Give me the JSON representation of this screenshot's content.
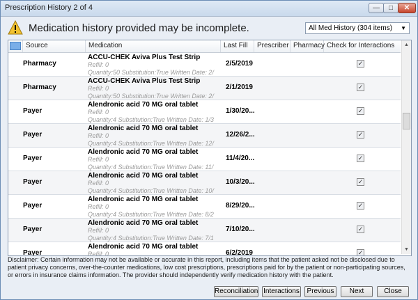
{
  "window": {
    "title": "Prescription History 2 of 4",
    "controls": [
      "min-icon",
      "max-icon",
      "close-icon"
    ]
  },
  "warning": {
    "icon": "warning-icon",
    "text": "Medication history provided may be incomplete."
  },
  "history_select": {
    "value": "All Med History (304 items)"
  },
  "columns": {
    "source": "Source",
    "medication": "Medication",
    "last_fill": "Last Fill",
    "prescriber": "Prescriber",
    "pharmacy": "Pharmacy",
    "check": "Check for Interactions"
  },
  "rows": [
    {
      "source": "Pharmacy",
      "name": "ACCU-CHEK Aviva Plus Test Strip",
      "refill": "Refill: 0",
      "details": "Quantity:50  Substitution:True Written Date: 2/",
      "last_fill": "2/5/2019",
      "checked": true
    },
    {
      "source": "Pharmacy",
      "name": "ACCU-CHEK Aviva Plus Test Strip",
      "refill": "Refill: 0",
      "details": "Quantity:50  Substitution:True Written Date: 2/",
      "last_fill": "2/1/2019",
      "checked": true
    },
    {
      "source": "Payer",
      "name": "Alendronic acid 70 MG oral tablet",
      "refill": "Refill: 0",
      "details": "Quantity:4  Substitution:True Written Date: 1/3",
      "last_fill": "1/30/20...",
      "checked": true
    },
    {
      "source": "Payer",
      "name": "Alendronic acid 70 MG oral tablet",
      "refill": "Refill: 0",
      "details": "Quantity:4  Substitution:True Written Date: 12/",
      "last_fill": "12/26/2...",
      "checked": true
    },
    {
      "source": "Payer",
      "name": "Alendronic acid 70 MG oral tablet",
      "refill": "Refill: 0",
      "details": "Quantity:4  Substitution:True Written Date: 11/",
      "last_fill": "11/4/20...",
      "checked": true
    },
    {
      "source": "Payer",
      "name": "Alendronic acid 70 MG oral tablet",
      "refill": "Refill: 0",
      "details": "Quantity:4  Substitution:True Written Date: 10/",
      "last_fill": "10/3/20...",
      "checked": true
    },
    {
      "source": "Payer",
      "name": "Alendronic acid 70 MG oral tablet",
      "refill": "Refill: 0",
      "details": "Quantity:4  Substitution:True Written Date: 8/2",
      "last_fill": "8/29/20...",
      "checked": true
    },
    {
      "source": "Payer",
      "name": "Alendronic acid 70 MG oral tablet",
      "refill": "Refill: 0",
      "details": "Quantity:4  Substitution:True Written Date: 7/1",
      "last_fill": "7/10/20...",
      "checked": true
    },
    {
      "source": "Payer",
      "name": "Alendronic acid 70 MG oral tablet",
      "refill": "Refill: 0",
      "details": "",
      "last_fill": "6/2/2019",
      "checked": true
    }
  ],
  "disclaimer": "Disclaimer: Certain information may not be available or accurate in this report, including items that the patient asked not be disclosed due to patient privacy concerns, over-the-counter medications, low cost prescriptions, prescriptions paid for by the patient or non-participating sources, or errors in insurance claims information. The provider should independently verify medication history with the patient.",
  "buttons": {
    "reconciliation": "Reconciliation",
    "interactions": "Interactions",
    "previous": "Previous",
    "next": "Next",
    "close": "Close"
  },
  "colors": {
    "accent": "#79aee8",
    "titlebar": "#c9d9ec",
    "warning": "#f2c230"
  }
}
